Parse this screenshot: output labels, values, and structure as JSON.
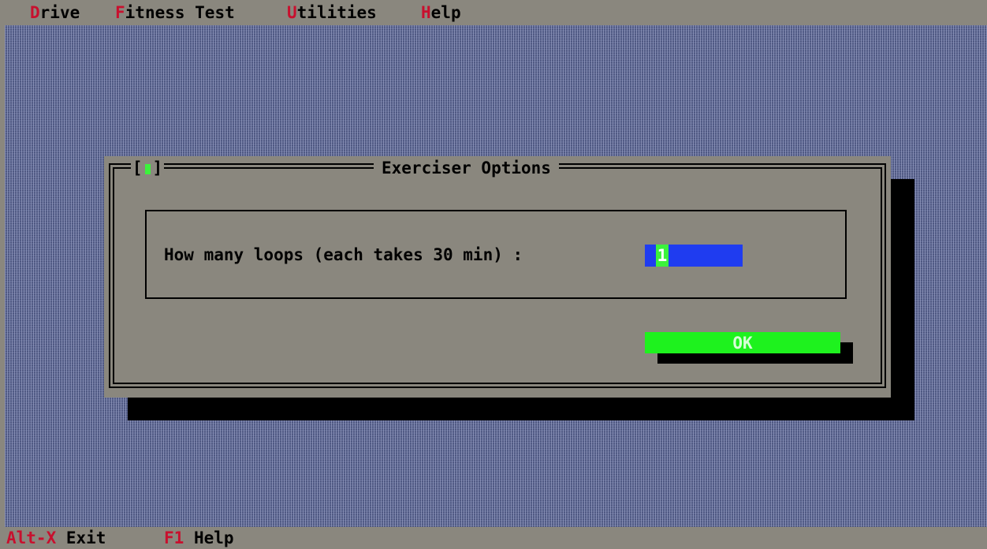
{
  "menubar": {
    "items": [
      {
        "hotkey": "D",
        "rest": "rive"
      },
      {
        "hotkey": "F",
        "rest": "itness Test"
      },
      {
        "hotkey": "U",
        "rest": "tilities"
      },
      {
        "hotkey": "H",
        "rest": "elp"
      }
    ]
  },
  "dialog": {
    "title": "Exerciser Options",
    "close_left": "[",
    "close_right": "]",
    "loops_label": "How many loops (each takes 30 min) :",
    "loops_value": "1",
    "ok_label": "OK"
  },
  "statusbar": {
    "items": [
      {
        "key": "Alt-X",
        "label": "Exit"
      },
      {
        "key": "F1",
        "label": "Help"
      }
    ]
  },
  "colors": {
    "chrome": "#8a877e",
    "desktop": "#5c6690",
    "hotkey": "#c8102e",
    "input": "#1f3cf0",
    "button": "#1ef21e"
  }
}
